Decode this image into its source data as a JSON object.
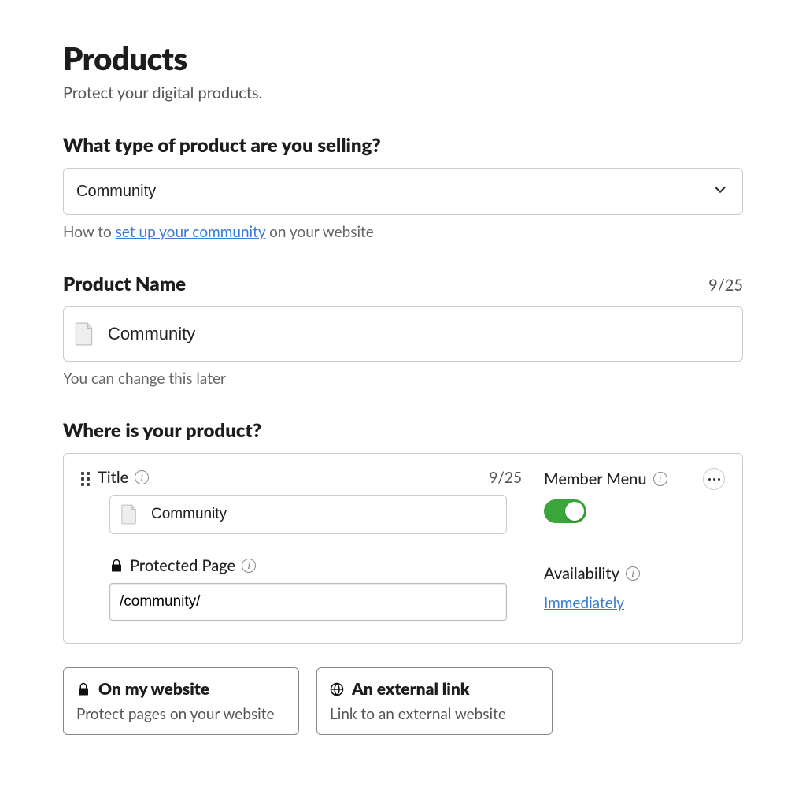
{
  "header": {
    "title": "Products",
    "subtitle": "Protect your digital products."
  },
  "productType": {
    "label": "What type of product are you selling?",
    "value": "Community",
    "helperPrefix": "How to ",
    "helperLink": "set up your community",
    "helperSuffix": " on your website"
  },
  "productName": {
    "label": "Product Name",
    "counter": "9/25",
    "value": "Community",
    "helper": "You can change this later"
  },
  "location": {
    "label": "Where is your product?",
    "titleLabel": "Title",
    "titleCounter": "9/25",
    "titleValue": "Community",
    "memberMenuLabel": "Member Menu",
    "memberMenuOn": true,
    "protectedLabel": "Protected Page",
    "protectedValue": "/community/",
    "availabilityLabel": "Availability",
    "availabilityValue": "Immediately"
  },
  "options": {
    "website": {
      "title": "On my website",
      "sub": "Protect pages on your website"
    },
    "external": {
      "title": "An external link",
      "sub": "Link to an external website"
    }
  }
}
